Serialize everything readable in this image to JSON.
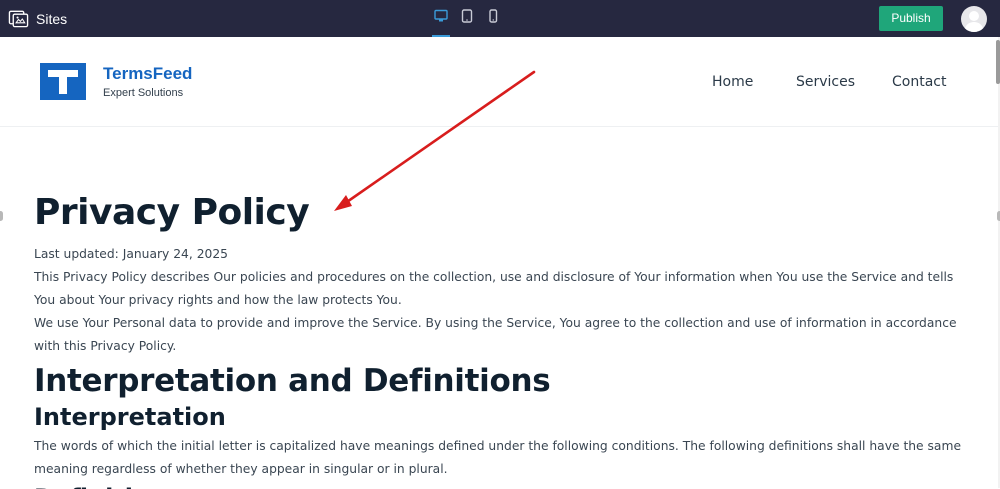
{
  "topbar": {
    "sites_label": "Sites",
    "publish_label": "Publish",
    "devices": [
      "desktop-icon",
      "tablet-icon",
      "mobile-icon"
    ],
    "active_device": "desktop"
  },
  "site": {
    "brand": "TermsFeed",
    "tagline": "Expert Solutions",
    "nav": [
      "Home",
      "Services",
      "Contact"
    ]
  },
  "content": {
    "title": "Privacy Policy",
    "last_updated": "Last updated: January 24, 2025",
    "intro_1": "This Privacy Policy describes Our policies and procedures on the collection, use and disclosure of Your information when You use the Service and tells You about Your privacy rights and how the law protects You.",
    "intro_2": "We use Your Personal data to provide and improve the Service. By using the Service, You agree to the collection and use of information in accordance with this Privacy Policy.",
    "section_title": "Interpretation and Definitions",
    "subsection_title": "Interpretation",
    "interpretation_text": "The words of which the initial letter is capitalized have meanings defined under the following conditions. The following definitions shall have the same meaning regardless of whether they appear in singular or in plural.",
    "next_heading": "Definitions"
  },
  "colors": {
    "topbar_bg": "#262840",
    "publish_bg": "#1fa67a",
    "brand": "#1565c0",
    "heading": "#10202f",
    "annotation_arrow": "#d81d1d"
  }
}
